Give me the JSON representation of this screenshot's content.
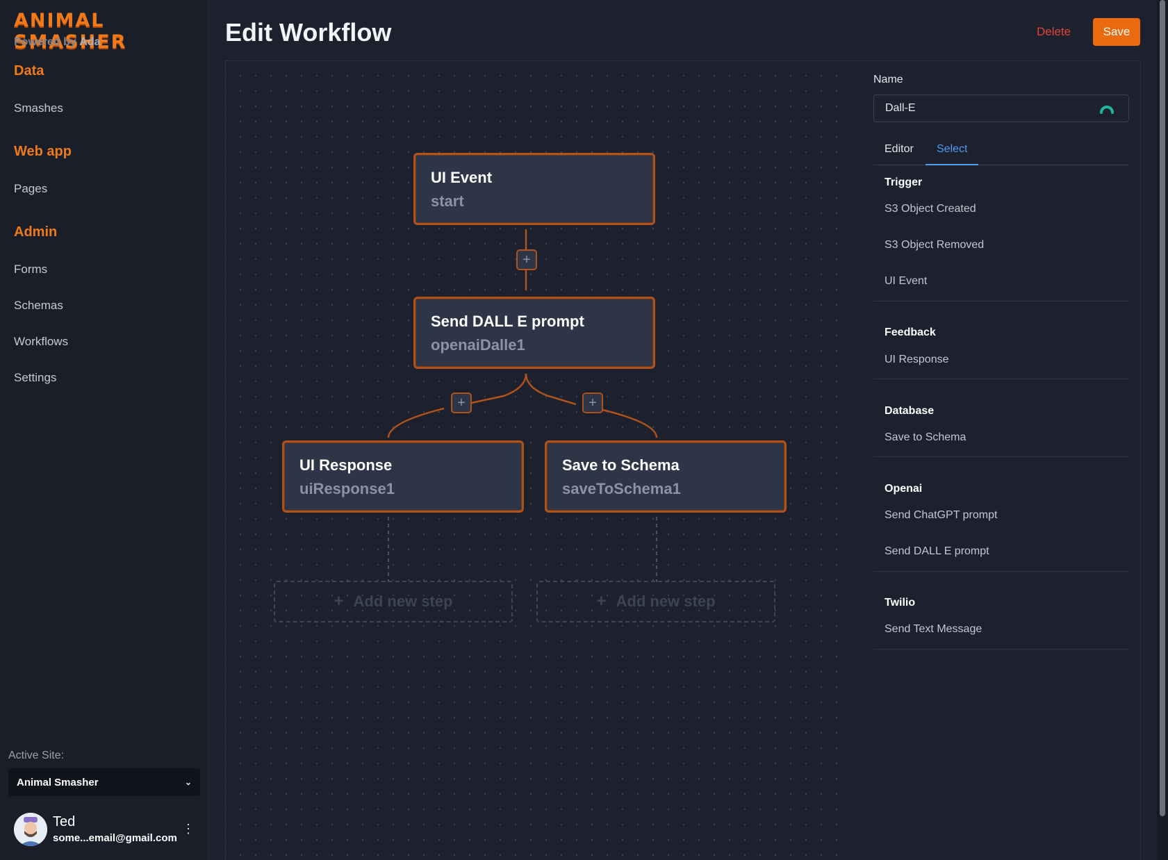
{
  "brand": {
    "logo": "ANIMAL SMASHER",
    "powered_prefix": "Powered by",
    "powered_name": "Ada"
  },
  "nav": {
    "sections": [
      {
        "label": "Data",
        "items": [
          "Smashes"
        ]
      },
      {
        "label": "Web app",
        "items": [
          "Pages"
        ]
      },
      {
        "label": "Admin",
        "items": [
          "Forms",
          "Schemas",
          "Workflows",
          "Settings"
        ]
      }
    ]
  },
  "site": {
    "label": "Active Site:",
    "selected": "Animal Smasher"
  },
  "user": {
    "name": "Ted",
    "email": "some...email@gmail.com"
  },
  "header": {
    "title": "Edit Workflow",
    "delete_label": "Delete",
    "save_label": "Save"
  },
  "workflow": {
    "nodes": [
      {
        "title": "UI Event",
        "id": "start"
      },
      {
        "title": "Send DALL E prompt",
        "id": "openaiDalle1"
      },
      {
        "title": "UI Response",
        "id": "uiResponse1"
      },
      {
        "title": "Save to Schema",
        "id": "saveToSchema1"
      }
    ],
    "add_step_label": "Add new step",
    "plus_symbol": "+"
  },
  "panel": {
    "name_label": "Name",
    "name_value": "Dall-E",
    "tabs": [
      "Editor",
      "Select"
    ],
    "active_tab": "Select",
    "groups": [
      {
        "title": "Trigger",
        "items": [
          "S3 Object Created",
          "S3 Object Removed",
          "UI Event"
        ]
      },
      {
        "title": "Feedback",
        "items": [
          "UI Response"
        ]
      },
      {
        "title": "Database",
        "items": [
          "Save to Schema"
        ]
      },
      {
        "title": "Openai",
        "items": [
          "Send ChatGPT prompt",
          "Send DALL E prompt"
        ]
      },
      {
        "title": "Twilio",
        "items": [
          "Send Text Message"
        ]
      }
    ]
  },
  "colors": {
    "accent": "#ea6a0f",
    "node_border": "#b0521c",
    "link": "#4f9cf0",
    "danger": "#e0443a",
    "background": "#1c212d"
  }
}
